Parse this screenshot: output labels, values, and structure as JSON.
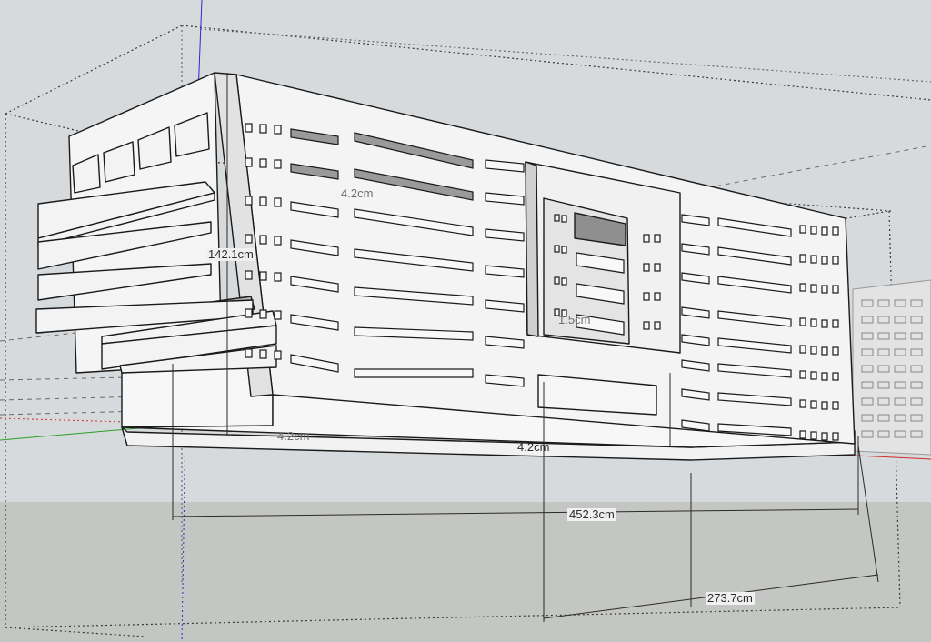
{
  "app": "SketchUp",
  "scene": {
    "sky_color": "#d6dadc",
    "ground_color": "#c4c6c3",
    "red_axis_color": "#d42a2a",
    "green_axis_color": "#2aa02a",
    "blue_axis_color": "#2a2ad0",
    "model_face_color": "#f2f2f2",
    "model_edge_color": "#1a1a1a"
  },
  "dimensions": {
    "height": "142.1cm",
    "length": "452.3cm",
    "depth": "273.7cm",
    "thickness_top": "4.2cm",
    "thickness_base_left": "4.2cm",
    "thickness_base_mid": "4.2cm",
    "center_offset": "1.5cm"
  }
}
